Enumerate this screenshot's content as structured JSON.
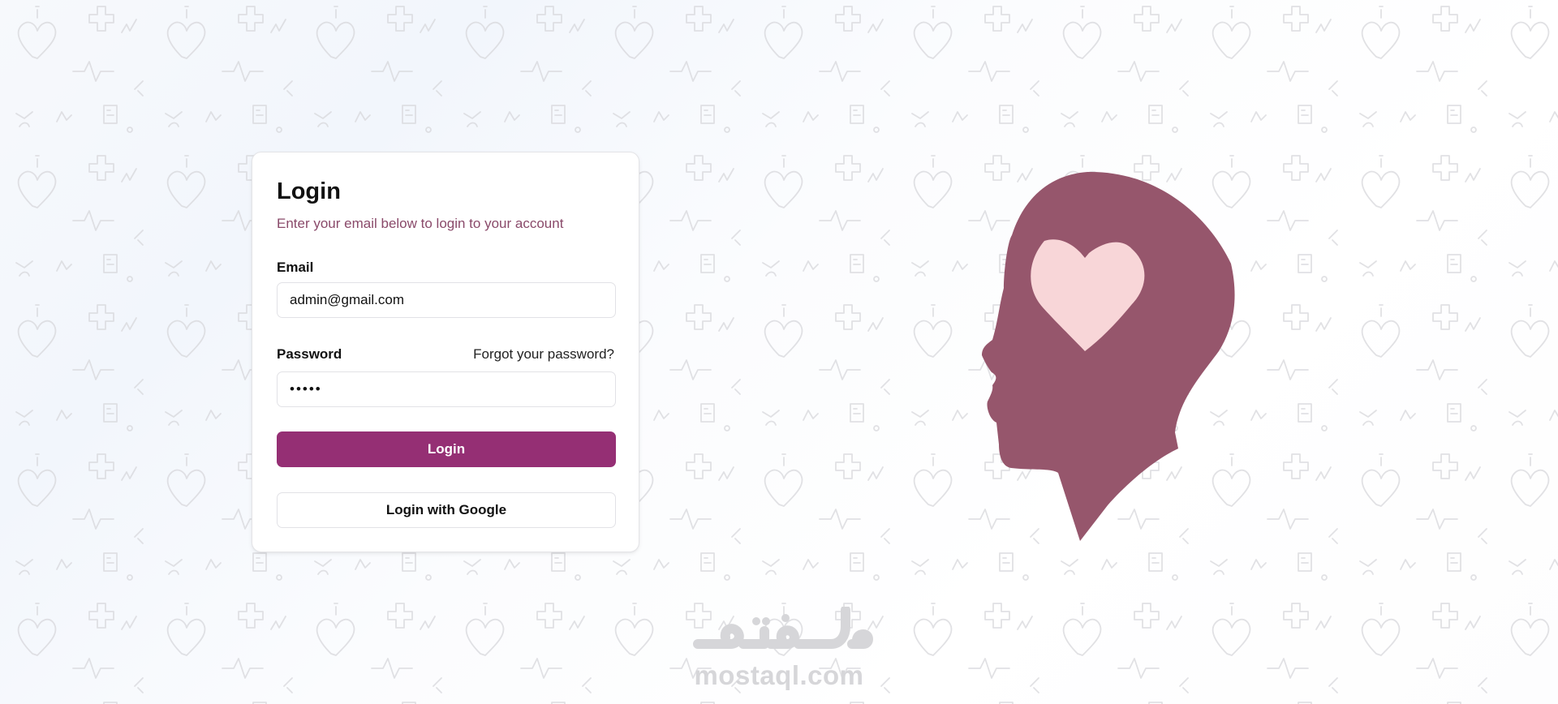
{
  "login": {
    "title": "Login",
    "subtitle": "Enter your email below to login to your account",
    "email_label": "Email",
    "email_value": "admin@gmail.com",
    "password_label": "Password",
    "forgot_link": "Forgot your password?",
    "password_value": "12345",
    "login_button": "Login",
    "google_button": "Login with Google"
  },
  "illustration": {
    "icon": "head-heart-icon",
    "head_color": "#96566c",
    "heart_color": "#f8d6d8"
  },
  "watermark": {
    "arabic": "مستقل",
    "url": "mostaql.com"
  },
  "colors": {
    "accent": "#952f74",
    "subtitle": "#8a4a6a",
    "pattern": "#d9d9dc"
  }
}
